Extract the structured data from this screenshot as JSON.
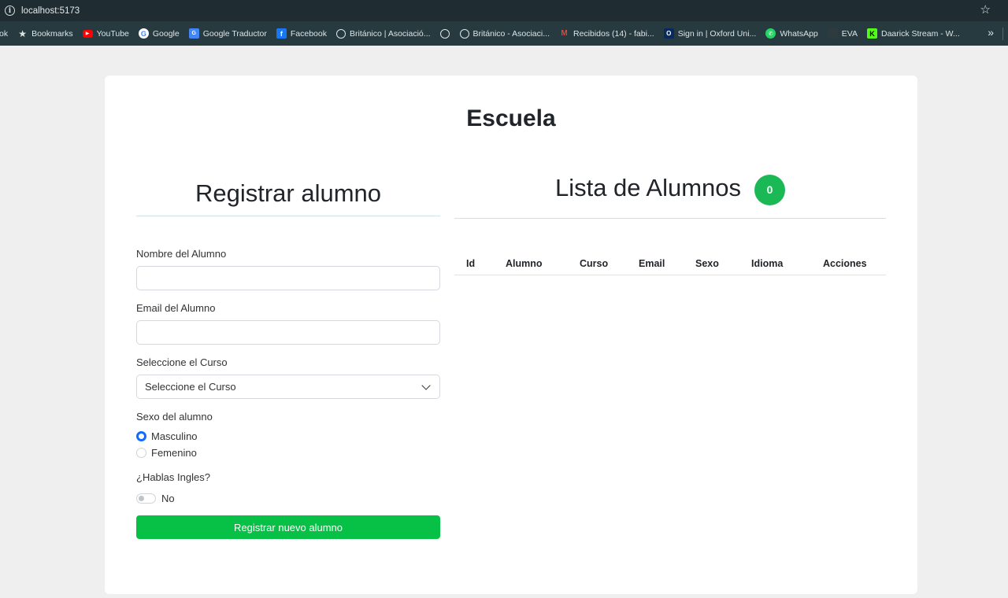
{
  "browser": {
    "url": "localhost:5173",
    "bookmarks": [
      {
        "label": "ok",
        "icon": "none"
      },
      {
        "label": "Bookmarks",
        "icon": "star-icon"
      },
      {
        "label": "YouTube",
        "icon": "youtube-icon"
      },
      {
        "label": "Google",
        "icon": "google-icon"
      },
      {
        "label": "Google Traductor",
        "icon": "google-translate-icon"
      },
      {
        "label": "Facebook",
        "icon": "facebook-icon"
      },
      {
        "label": "Británico | Asociació...",
        "icon": "globe-icon"
      },
      {
        "label": "",
        "icon": "globe-icon"
      },
      {
        "label": "Británico - Asociaci...",
        "icon": "globe-icon"
      },
      {
        "label": "Recibidos (14) - fabi...",
        "icon": "gmail-icon"
      },
      {
        "label": "Sign in | Oxford Uni...",
        "icon": "oxford-icon"
      },
      {
        "label": "WhatsApp",
        "icon": "whatsapp-icon"
      },
      {
        "label": "EVA",
        "icon": "eva-icon"
      },
      {
        "label": "Daarick Stream - W...",
        "icon": "kick-icon"
      }
    ],
    "more": "»"
  },
  "page": {
    "title": "Escuela"
  },
  "form": {
    "heading": "Registrar alumno",
    "name_label": "Nombre del Alumno",
    "name_value": "",
    "email_label": "Email del Alumno",
    "email_value": "",
    "course_label": "Seleccione el Curso",
    "course_selected": "Seleccione el Curso",
    "sex_label": "Sexo del alumno",
    "sex_options": [
      "Masculino",
      "Femenino"
    ],
    "sex_selected": "Masculino",
    "english_label": "¿Hablas Ingles?",
    "english_value": "No",
    "submit_label": "Registrar nuevo alumno"
  },
  "list": {
    "heading": "Lista de Alumnos",
    "count": "0",
    "columns": [
      "Id",
      "Alumno",
      "Curso",
      "Email",
      "Sexo",
      "Idioma",
      "Acciones"
    ],
    "rows": []
  },
  "colors": {
    "accent_green": "#07c046",
    "badge_green": "#1bb955",
    "radio_blue": "#0d6efd"
  }
}
